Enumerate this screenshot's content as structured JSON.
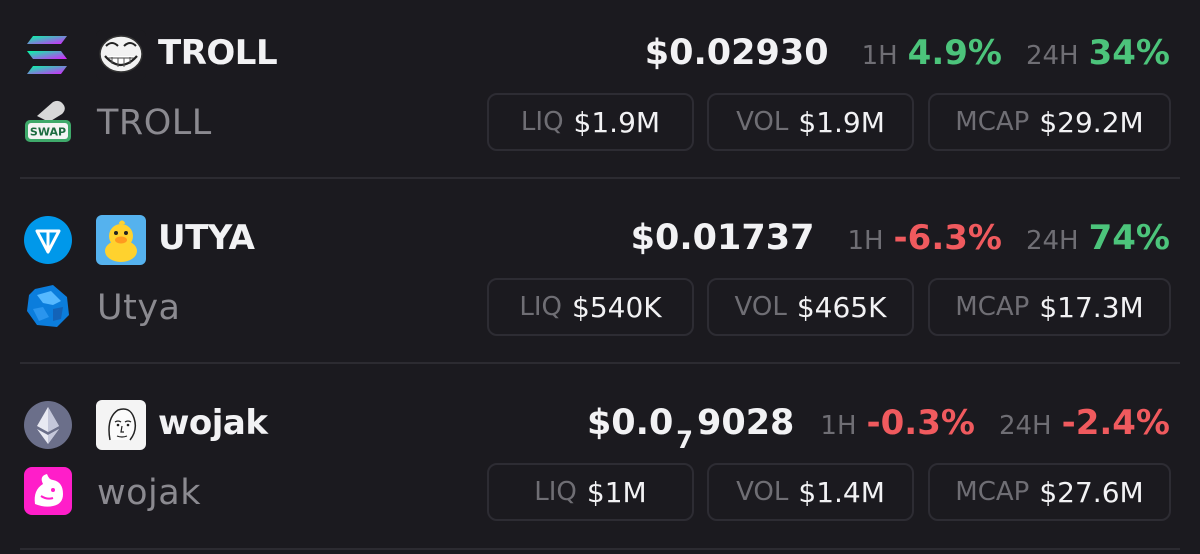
{
  "colors": {
    "background": "#1b1a1f",
    "positive": "#4cc47b",
    "negative": "#f05a5e",
    "muted": "#6f6e74"
  },
  "tokens": [
    {
      "chain_icon": "solana-icon",
      "dex_icon": "swap-badge-icon",
      "dex_badge_text": "SWAP",
      "avatar": "troll-face-avatar",
      "symbol": "TROLL",
      "name": "TROLL",
      "price_prefix": "$0.02930",
      "price_sub": "",
      "price_suffix": "",
      "h1_label": "1H",
      "h1_change": "4.9%",
      "h1_direction": "up",
      "h24_label": "24H",
      "h24_change": "34%",
      "h24_direction": "up",
      "liq_label": "LIQ",
      "liq_value": "$1.9M",
      "vol_label": "VOL",
      "vol_value": "$1.9M",
      "mcap_label": "MCAP",
      "mcap_value": "$29.2M"
    },
    {
      "chain_icon": "ton-icon",
      "dex_icon": "stonfi-icon",
      "avatar": "duck-avatar",
      "symbol": "UTYA",
      "name": "Utya",
      "price_prefix": "$0.01737",
      "price_sub": "",
      "price_suffix": "",
      "h1_label": "1H",
      "h1_change": "-6.3%",
      "h1_direction": "down",
      "h24_label": "24H",
      "h24_change": "74%",
      "h24_direction": "up",
      "liq_label": "LIQ",
      "liq_value": "$540K",
      "vol_label": "VOL",
      "vol_value": "$465K",
      "mcap_label": "MCAP",
      "mcap_value": "$17.3M"
    },
    {
      "chain_icon": "ethereum-icon",
      "dex_icon": "uniswap-icon",
      "avatar": "wojak-avatar",
      "symbol": "wojak",
      "name": "wojak",
      "price_prefix": "$0.0",
      "price_sub": "7",
      "price_suffix": "9028",
      "h1_label": "1H",
      "h1_change": "-0.3%",
      "h1_direction": "down",
      "h24_label": "24H",
      "h24_change": "-2.4%",
      "h24_direction": "down",
      "liq_label": "LIQ",
      "liq_value": "$1M",
      "vol_label": "VOL",
      "vol_value": "$1.4M",
      "mcap_label": "MCAP",
      "mcap_value": "$27.6M"
    }
  ]
}
